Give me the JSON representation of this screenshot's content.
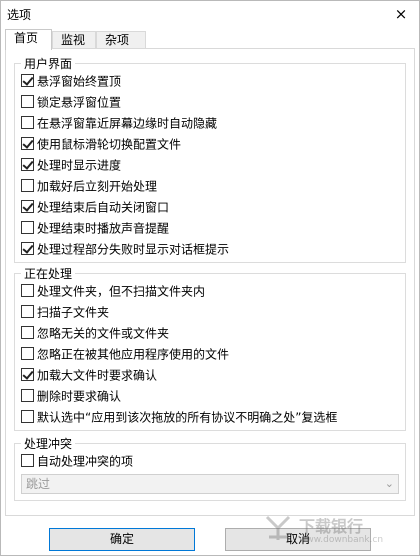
{
  "window": {
    "title": "选项",
    "close_glyph": "×"
  },
  "tabs": [
    {
      "label": "首页",
      "active": true
    },
    {
      "label": "监视",
      "active": false
    },
    {
      "label": "杂项",
      "active": false
    }
  ],
  "groups": {
    "ui": {
      "title": "用户界面",
      "items": [
        {
          "label": "悬浮窗始终置顶",
          "checked": true
        },
        {
          "label": "锁定悬浮窗位置",
          "checked": false
        },
        {
          "label": "在悬浮窗靠近屏幕边缘时自动隐藏",
          "checked": false
        },
        {
          "label": "使用鼠标滑轮切换配置文件",
          "checked": true
        },
        {
          "label": "处理时显示进度",
          "checked": true
        },
        {
          "label": "加载好后立刻开始处理",
          "checked": false
        },
        {
          "label": "处理结束后自动关闭窗口",
          "checked": true
        },
        {
          "label": "处理结束时播放声音提醒",
          "checked": false
        },
        {
          "label": "处理过程部分失败时显示对话框提示",
          "checked": true
        }
      ]
    },
    "processing": {
      "title": "正在处理",
      "items": [
        {
          "label": "处理文件夹，但不扫描文件夹内",
          "checked": false
        },
        {
          "label": "扫描子文件夹",
          "checked": false
        },
        {
          "label": "忽略无关的文件或文件夹",
          "checked": false
        },
        {
          "label": "忽略正在被其他应用程序使用的文件",
          "checked": false
        },
        {
          "label": "加载大文件时要求确认",
          "checked": true
        },
        {
          "label": "删除时要求确认",
          "checked": false
        },
        {
          "label": "默认选中“应用到该次拖放的所有协议不明确之处”复选框",
          "checked": false
        }
      ]
    },
    "conflict": {
      "title": "处理冲突",
      "items": [
        {
          "label": "自动处理冲突的项",
          "checked": false
        }
      ],
      "select_value": "跳过"
    }
  },
  "buttons": {
    "ok": "确定",
    "cancel": "取消"
  },
  "watermark": {
    "text": "下载银行",
    "sub": "www.downbank.cn"
  },
  "colors": {
    "accent": "#0078d7",
    "check": "#222222"
  }
}
